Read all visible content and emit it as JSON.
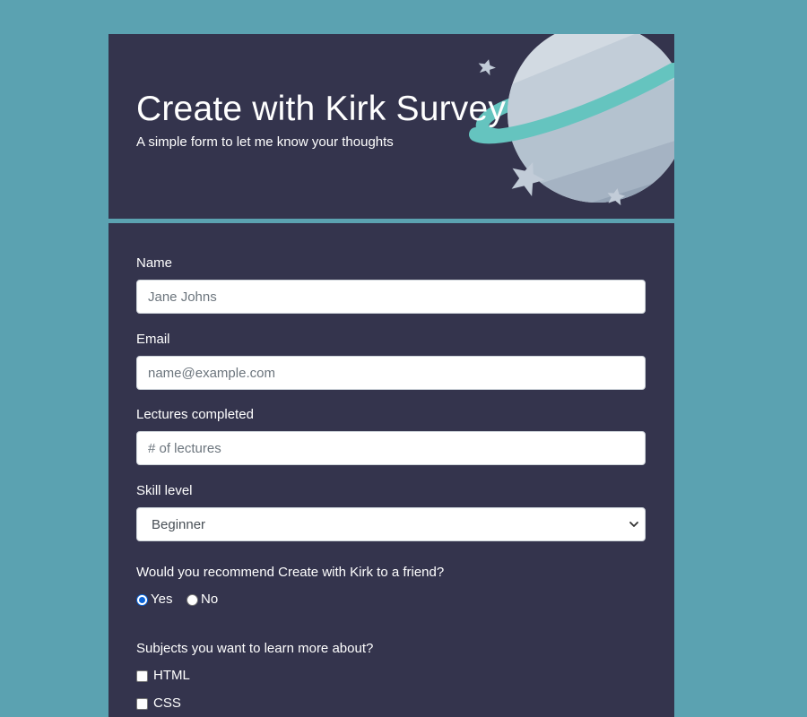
{
  "header": {
    "title": "Create with Kirk Survey",
    "subtitle": "A simple form to let me know your thoughts"
  },
  "form": {
    "name": {
      "label": "Name",
      "placeholder": "Jane Johns",
      "value": ""
    },
    "email": {
      "label": "Email",
      "placeholder": "name@example.com",
      "value": ""
    },
    "lectures": {
      "label": "Lectures completed",
      "placeholder": "# of lectures",
      "value": ""
    },
    "skill": {
      "label": "Skill level",
      "selected": "Beginner"
    },
    "recommend": {
      "question": "Would you recommend Create with Kirk to a friend?",
      "options": [
        {
          "label": "Yes",
          "checked": true
        },
        {
          "label": "No",
          "checked": false
        }
      ]
    },
    "subjects": {
      "question": "Subjects you want to learn more about?",
      "options": [
        {
          "label": "HTML",
          "checked": false
        },
        {
          "label": "CSS",
          "checked": false
        }
      ]
    }
  },
  "colors": {
    "background": "#5ba2b1",
    "card": "#34344d",
    "ring": "#65c4bf",
    "planet_light": "#d2dae2",
    "planet_mid": "#b4c2cf",
    "planet_dark": "#94a3b5",
    "star": "#c2ccd8"
  },
  "icons": {
    "planet": "planet-illustration",
    "stars": "sparkle-star-icon",
    "select_arrow": "chevron-down-icon"
  }
}
